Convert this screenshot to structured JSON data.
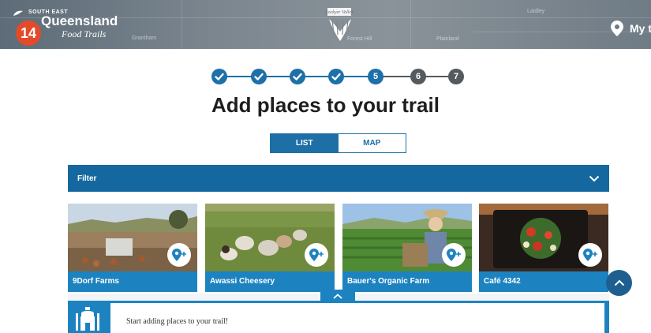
{
  "header": {
    "badge": "14",
    "logo_small": "SOUTH EAST",
    "logo_main": "Queensland",
    "logo_sub": "Food Trails",
    "center_logo_text": "Lockyer Valley",
    "my_trail_label": "My t",
    "map_labels": [
      "Grantham",
      "Laidley",
      "Plainland",
      "Forest Hill"
    ]
  },
  "steps": {
    "items": [
      {
        "label": "",
        "state": "done"
      },
      {
        "label": "",
        "state": "done"
      },
      {
        "label": "",
        "state": "done"
      },
      {
        "label": "",
        "state": "done"
      },
      {
        "label": "5",
        "state": "current"
      },
      {
        "label": "6",
        "state": "todo"
      },
      {
        "label": "7",
        "state": "todo"
      }
    ]
  },
  "title": "Add places to your trail",
  "toggle": {
    "list_label": "LIST",
    "map_label": "MAP",
    "selected": "LIST"
  },
  "filter": {
    "label": "Filter"
  },
  "cards": [
    {
      "name": "9Dorf Farms"
    },
    {
      "name": "Awassi Cheesery"
    },
    {
      "name": "Bauer's Organic Farm"
    },
    {
      "name": "Café 4342"
    }
  ],
  "panel": {
    "message": "Start adding places to your trail!"
  },
  "colors": {
    "primary": "#1d70a8",
    "card_label": "#1d83c0",
    "filter_bar": "#14689f",
    "badge": "#e44a2a",
    "step_todo": "#555a5e"
  }
}
